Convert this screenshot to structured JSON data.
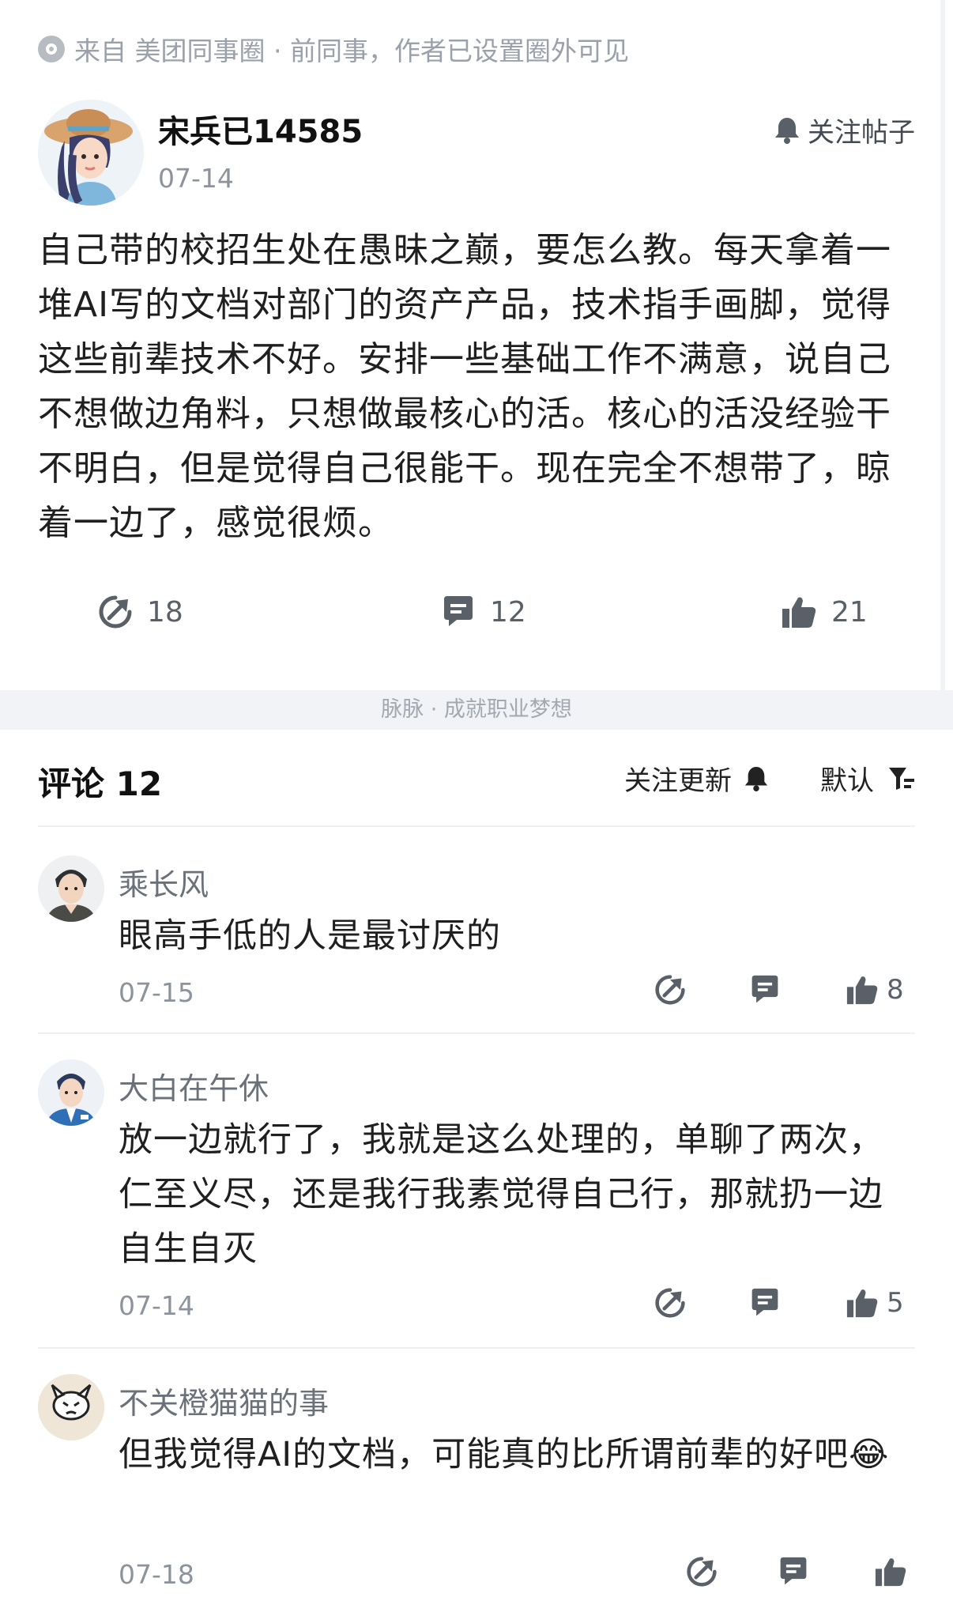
{
  "post": {
    "source": "来自 美团同事圈 · 前同事，作者已设置圈外可见",
    "author_name": "宋兵已14585",
    "date": "07-14",
    "follow_label": "关注帖子",
    "body": "自己带的校招生处在愚昧之巅，要怎么教。每天拿着一堆AI写的文档对部门的资产产品，技术指手画脚，觉得这些前辈技术不好。安排一些基础工作不满意，说自己不想做边角料，只想做最核心的活。核心的活没经验干不明白，但是觉得自己很能干。现在完全不想带了，晾着一边了，感觉很烦。",
    "share_count": "18",
    "comment_count": "12",
    "like_count": "21"
  },
  "slogan": "脉脉 · 成就职业梦想",
  "comments_header": {
    "title": "评论 12",
    "follow_updates_label": "关注更新",
    "sort_label": "默认"
  },
  "comments": [
    {
      "name": "乘长风",
      "text": "眼高手低的人是最讨厌的",
      "date": "07-15",
      "likes": "8"
    },
    {
      "name": "大白在午休",
      "text": "放一边就行了，我就是这么处理的，单聊了两次，仁至义尽，还是我行我素觉得自己行，那就扔一边自生自灭",
      "date": "07-14",
      "likes": "5"
    },
    {
      "name": "不关橙猫猫的事",
      "text": "但我觉得AI的文档，可能真的比所谓前辈的好吧😂",
      "date": "07-18",
      "likes": ""
    }
  ],
  "icons": {
    "source": "circle-dot-icon",
    "bell": "bell-icon",
    "share": "share-icon",
    "comment": "comment-icon",
    "like": "thumbs-up-icon",
    "filter": "filter-icon"
  },
  "colors": {
    "text_primary": "#1f1f1f",
    "text_muted": "#8c939c",
    "band": "#f1f3f6"
  }
}
